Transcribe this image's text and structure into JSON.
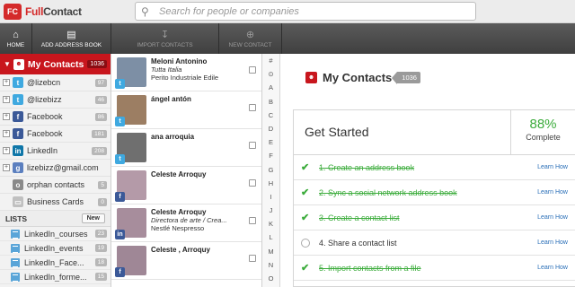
{
  "header": {
    "logo_mark": "FC",
    "logo_brand": "Full",
    "logo_brand_rest": "Contact",
    "search_placeholder": "Search for people or companies"
  },
  "toolbar": {
    "home": "HOME",
    "add_address_book": "ADD ADDRESS BOOK",
    "import_contacts": "IMPORT CONTACTS",
    "new_contact": "NEW CONTACT"
  },
  "sidebar": {
    "my_contacts": {
      "label": "My Contacts",
      "count": "1036"
    },
    "sources": [
      {
        "name": "@lizebcn",
        "icon": "twitter-icon",
        "glyph": "t",
        "cls": "tw",
        "count": "97"
      },
      {
        "name": "@lizebizz",
        "icon": "twitter-icon",
        "glyph": "t",
        "cls": "tw",
        "count": "46"
      },
      {
        "name": "Facebook",
        "icon": "facebook-icon",
        "glyph": "f",
        "cls": "fb",
        "count": "86"
      },
      {
        "name": "Facebook",
        "icon": "facebook-icon",
        "glyph": "f",
        "cls": "fb",
        "count": "181"
      },
      {
        "name": "LinkedIn",
        "icon": "linkedin-icon",
        "glyph": "in",
        "cls": "li",
        "count": "208"
      },
      {
        "name": "lizebizz@gmail.com",
        "icon": "google-icon",
        "glyph": "g",
        "cls": "gg",
        "count": ""
      },
      {
        "name": "orphan contacts",
        "icon": "orphan-icon",
        "glyph": "o",
        "cls": "or",
        "count": "5"
      },
      {
        "name": "Business Cards",
        "icon": "business-card-icon",
        "glyph": "▭",
        "cls": "bc",
        "count": "0"
      }
    ],
    "lists_label": "LISTS",
    "new_label": "New",
    "lists": [
      {
        "name": "LinkedIn_courses",
        "count": "23"
      },
      {
        "name": "LinkedIn_events",
        "count": "19"
      },
      {
        "name": "LinkedIn_Face...",
        "count": "18"
      },
      {
        "name": "LinkedIn_forme...",
        "count": "15"
      }
    ]
  },
  "contacts": [
    {
      "name": "Meloni Antonino",
      "line1": "Tutta Italia",
      "line2": "Perito Industriale Edile",
      "badge": "t",
      "badge_cls": "tw-badge",
      "avatar": "#7d8fa5"
    },
    {
      "name": "ángel antón",
      "line1": "",
      "line2": "",
      "badge": "t",
      "badge_cls": "tw-badge",
      "avatar": "#9c7e63"
    },
    {
      "name": "ana arroquia",
      "line1": "",
      "line2": "",
      "badge": "t",
      "badge_cls": "tw-badge",
      "avatar": "#6f6f6f"
    },
    {
      "name": "Celeste Arroquy",
      "line1": "",
      "line2": "",
      "badge": "f",
      "badge_cls": "fb-badge",
      "avatar": "#b49aa8"
    },
    {
      "name": "Celeste Arroquy",
      "line1": "Directora de arte / Crea...",
      "line2": "Nestlé Nespresso",
      "badge": "in",
      "badge_cls": "fb-badge",
      "avatar": "#a78d9c"
    },
    {
      "name": "Celeste , Arroquy",
      "line1": "",
      "line2": "",
      "badge": "f",
      "badge_cls": "fb-badge",
      "avatar": "#9f8796"
    }
  ],
  "alphabet": [
    "#",
    "⊙",
    "A",
    "B",
    "C",
    "D",
    "E",
    "F",
    "G",
    "H",
    "I",
    "J",
    "K",
    "L",
    "M",
    "N",
    "O"
  ],
  "main": {
    "title": "My Contacts",
    "count": "1036",
    "get_started": "Get Started",
    "percent": "88%",
    "complete": "Complete",
    "learn_how": "Learn How",
    "tasks": [
      {
        "label": "1. Create an address book",
        "done": true
      },
      {
        "label": "2. Sync a social network address book",
        "done": true
      },
      {
        "label": "3. Create a contact list",
        "done": true
      },
      {
        "label": "4. Share a contact list",
        "done": false
      },
      {
        "label": "5. Import contacts from a file",
        "done": true
      }
    ]
  },
  "colors": {
    "brand_red": "#c8161d",
    "toolbar": "#4a4a4a",
    "done_green": "#3cac3c",
    "link_blue": "#2a6fb8"
  }
}
